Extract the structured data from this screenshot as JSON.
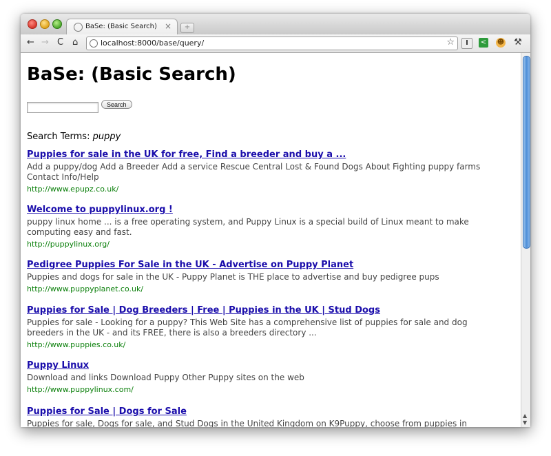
{
  "browser": {
    "tab_title": "BaSe: (Basic Search)",
    "tab_close": "×",
    "new_tab": "+",
    "url": "localhost:8000/base/query/",
    "nav": {
      "back": "←",
      "forward": "→",
      "reload": "C",
      "home": "⌂"
    },
    "star": "☆",
    "extensions": [
      {
        "icon": "text-cursor-icon",
        "glyph": "I"
      },
      {
        "icon": "share-icon",
        "glyph": "<"
      },
      {
        "icon": "cookie-icon",
        "glyph": "☻"
      },
      {
        "icon": "wrench-icon",
        "glyph": "⚒"
      }
    ]
  },
  "page": {
    "heading": "BaSe: (Basic Search)",
    "search_input_value": "",
    "search_button": "Search",
    "terms_label": "Search Terms:",
    "terms_value": "puppy"
  },
  "results": [
    {
      "title": "Puppies for sale in the UK for free, Find a breeder and buy a ...",
      "snippet": "Add a puppy/dog Add a Breeder Add a service Rescue Central Lost & Found Dogs About Fighting puppy farms Contact Info/Help",
      "url": "http://www.epupz.co.uk/"
    },
    {
      "title": "Welcome to puppylinux.org !",
      "snippet": "puppy linux home ... is a free operating system, and Puppy Linux is a special build of Linux meant to make computing easy and fast.",
      "url": "http://puppylinux.org/"
    },
    {
      "title": "Pedigree Puppies For Sale in the UK - Advertise on Puppy Planet",
      "snippet": "Puppies and dogs for sale in the UK - Puppy Planet is THE place to advertise and buy pedigree pups",
      "url": "http://www.puppyplanet.co.uk/"
    },
    {
      "title": "Puppies for Sale | Dog Breeders | Free | Puppies in the UK | Stud Dogs",
      "snippet": "Puppies for sale - Looking for a puppy? This Web Site has a comprehensive list of puppies for sale and dog breeders in the UK - and its FREE, there is also a breeders directory ...",
      "url": "http://www.puppies.co.uk/"
    },
    {
      "title": "Puppy Linux",
      "snippet": "Download and links Download Puppy Other Puppy sites on the web",
      "url": "http://www.puppylinux.com/"
    },
    {
      "title": "Puppies for Sale | Dogs for Sale",
      "snippet": "Puppies for sale, Dogs for sale, and Stud Dogs in the United Kingdom on K9Puppy, choose from puppies in",
      "url": ""
    }
  ]
}
